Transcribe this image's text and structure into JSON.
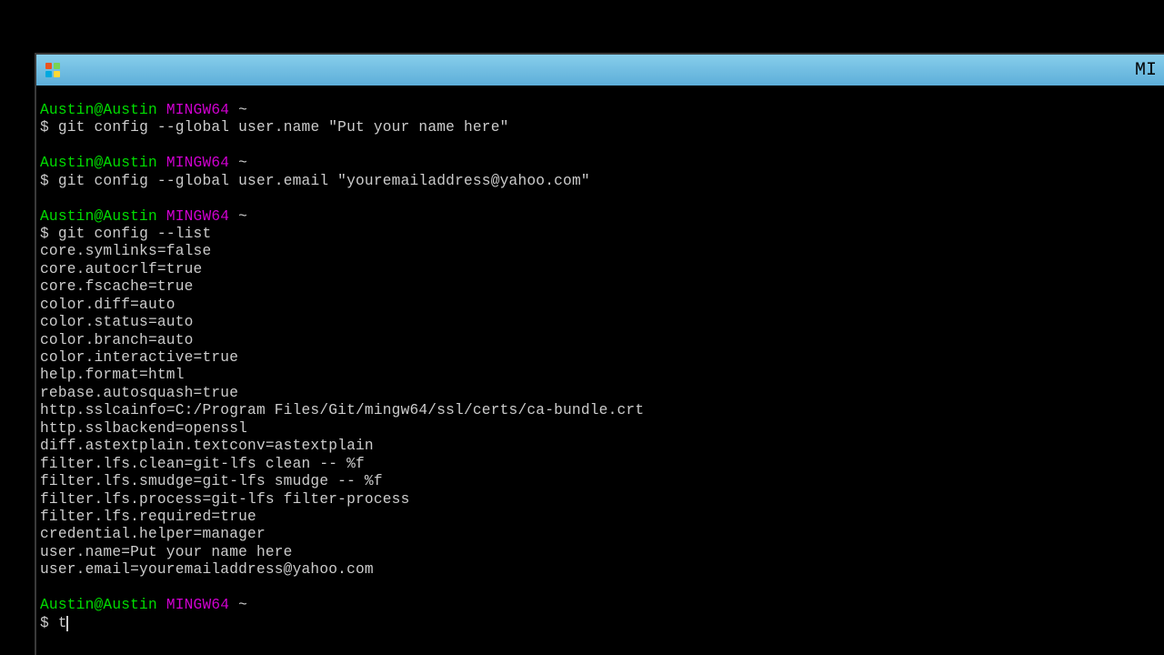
{
  "title_bar": {
    "text": "MI"
  },
  "prompt": {
    "user": "Austin@Austin",
    "env": "MINGW64",
    "path": "~",
    "symbol": "$"
  },
  "blocks": [
    {
      "command": "git config --global user.name \"Put your name here\"",
      "output": []
    },
    {
      "command": "git config --global user.email \"youremailaddress@yahoo.com\"",
      "output": []
    },
    {
      "command": "git config --list",
      "output": [
        "core.symlinks=false",
        "core.autocrlf=true",
        "core.fscache=true",
        "color.diff=auto",
        "color.status=auto",
        "color.branch=auto",
        "color.interactive=true",
        "help.format=html",
        "rebase.autosquash=true",
        "http.sslcainfo=C:/Program Files/Git/mingw64/ssl/certs/ca-bundle.crt",
        "http.sslbackend=openssl",
        "diff.astextplain.textconv=astextplain",
        "filter.lfs.clean=git-lfs clean -- %f",
        "filter.lfs.smudge=git-lfs smudge -- %f",
        "filter.lfs.process=git-lfs filter-process",
        "filter.lfs.required=true",
        "credential.helper=manager",
        "user.name=Put your name here",
        "user.email=youremailaddress@yahoo.com"
      ]
    }
  ],
  "current_input": "t"
}
